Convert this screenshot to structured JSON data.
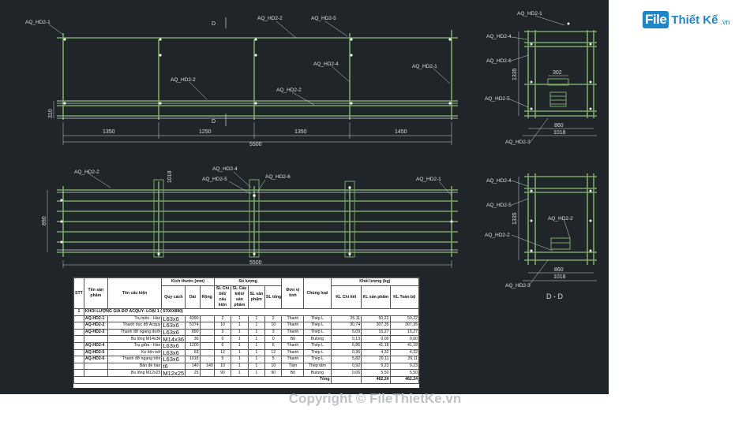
{
  "brand": {
    "mark": "File",
    "name": "Thiết Kế",
    "suffix": ".vn"
  },
  "watermark": "Copyright © FileThietKe.vn",
  "labels": {
    "aq1": "AQ_HD2-1",
    "aq2": "AQ_HD2-2",
    "aq3": "AQ_HD2-3",
    "aq4": "AQ_HD2-4",
    "aq5": "AQ_HD2-5",
    "aq6": "AQ_HD2-6",
    "section_mark": "D",
    "section_title": "D - D"
  },
  "dimensions": {
    "d1350a": "1350",
    "d1250": "1250",
    "d1350b": "1350",
    "d1450": "1450",
    "d5500a": "5500",
    "d5500b": "5500",
    "d310": "310",
    "d1018a": "1018",
    "d890": "890",
    "d1335a": "1335",
    "d302": "302",
    "d860a": "860",
    "d1018b": "1018",
    "d1018c": "1018",
    "d1335b": "1335",
    "d860b": "860",
    "d1018d": "1018"
  },
  "table": {
    "headers": {
      "stt": "STT",
      "ten_san_pham": "Tên sản phẩm",
      "ten_cau_kien": "Tên cấu kiện",
      "kich_thuoc": "Kích thước (mm)",
      "quy_cach": "Quy cách",
      "dai": "Dài",
      "rong": "Rộng",
      "so_luong": "Số lượng",
      "sl_chi_tiet": "SL Chi tiết/ cấu kiện",
      "sl_cau_kien": "SL Cấu kiện/ sản phẩm",
      "sl_san_pham": "SL sản phẩm",
      "sl_tong": "SL tổng",
      "don_vi": "Đơn vị tính",
      "chung_loai": "Chủng loại",
      "khoi_luong": "Khối lượng (kg)",
      "kl_chi_tiet": "KL Chi tiết",
      "kl_san_pham": "KL sản phẩm",
      "kl_toan_bo": "KL Toàn bộ"
    },
    "section": {
      "stt": "1",
      "title": "KHỐI LƯỢNG GIÁ ĐỠ ACQUY- LOẠI 1 ( 5700X890)"
    },
    "rows": [
      {
        "code": "AQ-HD2-1",
        "name": "Trụ biên - Hàn",
        "spec": "L63x6",
        "len": "4390",
        "wid": "",
        "q1": "2",
        "q2": "1",
        "q3": "1",
        "qt": "2",
        "unit": "Thanh",
        "mat": "Thép L",
        "w1": "25,11",
        "w2": "50,22",
        "w3": "50,22"
      },
      {
        "code": "AQ-HD2-2",
        "name": "Thanh dọc đỡ Acquy",
        "spec": "L63x6",
        "len": "5374",
        "wid": "",
        "q1": "10",
        "q2": "1",
        "q3": "1",
        "qt": "10",
        "unit": "Thanh",
        "mat": "Thép L",
        "w1": "30,74",
        "w2": "307,35",
        "w3": "307,35"
      },
      {
        "code": "AQ-HD2-3",
        "name": "Thanh đỡ ngang dưới",
        "spec": "L63x6",
        "len": "890",
        "wid": "",
        "q1": "3",
        "q2": "1",
        "q3": "1",
        "qt": "3",
        "unit": "Thanh",
        "mat": "Thép L",
        "w1": "5,09",
        "w2": "15,27",
        "w3": "15,27"
      },
      {
        "code": "",
        "name": "Bu lông M14x36",
        "spec": "M14x36",
        "len": "36",
        "wid": "",
        "q1": "0",
        "q2": "1",
        "q3": "1",
        "qt": "0",
        "unit": "Bộ",
        "mat": "Bulong",
        "w1": "0,13",
        "w2": "0,00",
        "w3": "0,00"
      },
      {
        "code": "AQ-HD2-4",
        "name": "Trụ giữa - Hàn",
        "spec": "L63x6",
        "len": "1200",
        "wid": "",
        "q1": "6",
        "q2": "1",
        "q3": "1",
        "qt": "6",
        "unit": "Thanh",
        "mat": "Thép L",
        "w1": "6,86",
        "w2": "41,18",
        "w3": "41,18"
      },
      {
        "code": "AQ-HD2-5",
        "name": "Ke liên kết",
        "spec": "L63x6",
        "len": "63",
        "wid": "",
        "q1": "12",
        "q2": "1",
        "q3": "1",
        "qt": "12",
        "unit": "Thanh",
        "mat": "Thép L",
        "w1": "0,36",
        "w2": "4,32",
        "w3": "4,32"
      },
      {
        "code": "AQ-HD2-6",
        "name": "Thanh đỡ ngang trên",
        "spec": "L63x6",
        "len": "1018",
        "wid": "",
        "q1": "5",
        "q2": "1",
        "q3": "1",
        "qt": "5",
        "unit": "Thanh",
        "mat": "Thép L",
        "w1": "5,82",
        "w2": "29,11",
        "w3": "29,11"
      },
      {
        "code": "",
        "name": "Bản đế hàn",
        "spec": "t6",
        "len": "140",
        "wid": "140",
        "q1": "10",
        "q2": "1",
        "q3": "1",
        "qt": "10",
        "unit": "Tấm",
        "mat": "Thép tấm",
        "w1": "0,92",
        "w2": "9,23",
        "w3": "9,23"
      },
      {
        "code": "",
        "name": "Bu lông M12x25",
        "spec": "M12x25",
        "len": "25",
        "wid": "",
        "q1": "90",
        "q2": "1",
        "q3": "1",
        "qt": "90",
        "unit": "Bộ",
        "mat": "Bulong",
        "w1": "0,06",
        "w2": "5,50",
        "w3": "5,50"
      }
    ],
    "total": {
      "label": "Tổng",
      "w2": "462,24",
      "w3": "462,24"
    }
  },
  "colors": {
    "canvas": "#1f2529",
    "steel": "#7aa86a",
    "brand": "#1e86c8"
  }
}
